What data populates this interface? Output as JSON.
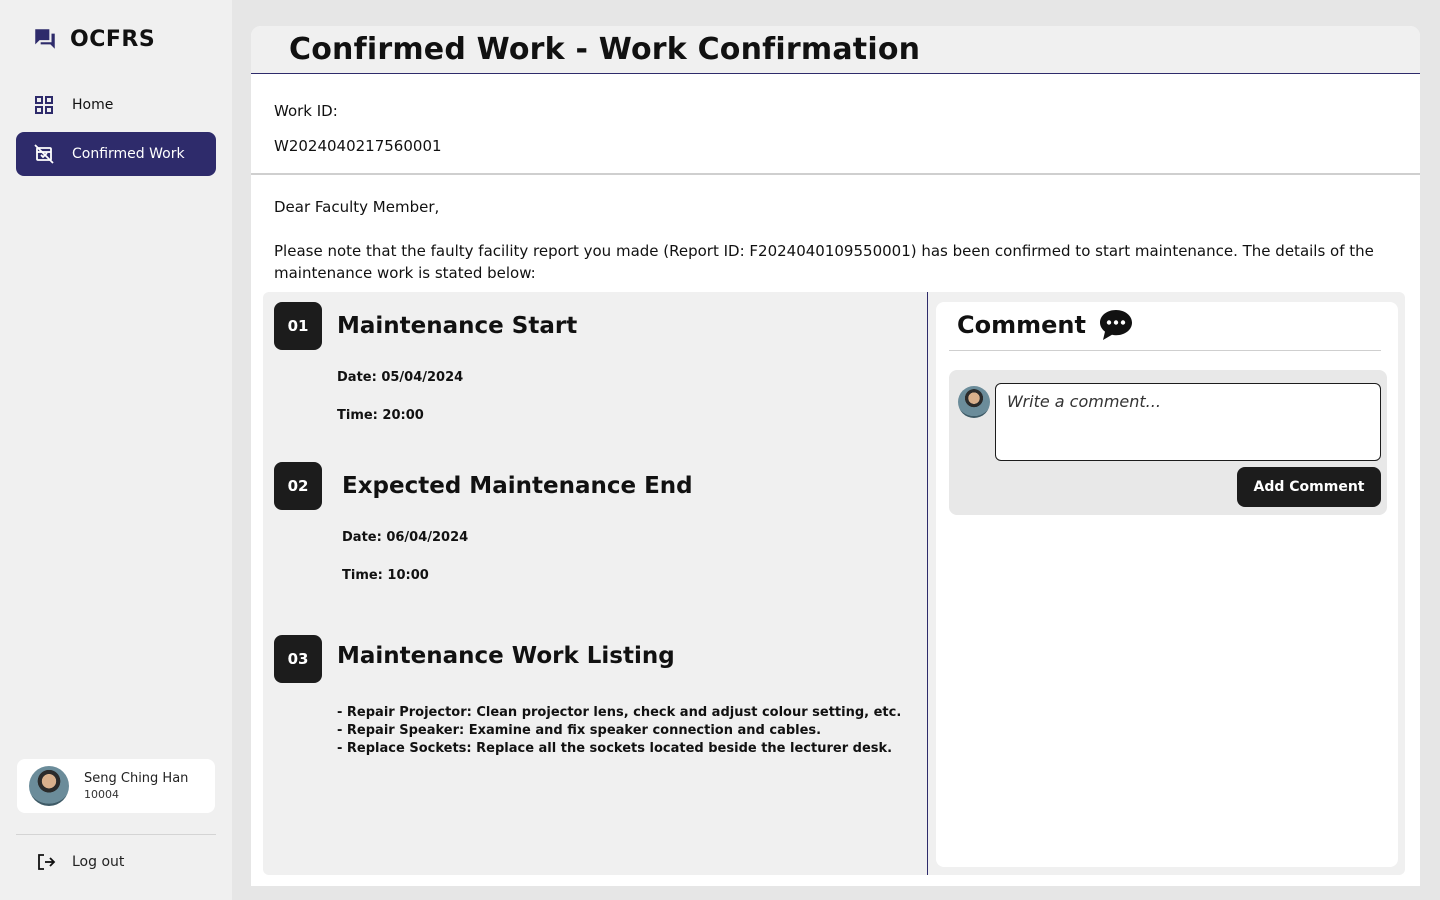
{
  "app": {
    "name": "OCFRS"
  },
  "sidebar": {
    "items": [
      {
        "label": "Home",
        "icon": "grid-icon",
        "active": false
      },
      {
        "label": "Confirmed Work",
        "icon": "confirmed-work-icon",
        "active": true
      }
    ],
    "user": {
      "name": "Seng Ching Han",
      "id": "10004"
    },
    "logout_label": "Log out"
  },
  "page": {
    "title": "Confirmed Work - Work Confirmation",
    "work_id_label": "Work ID:",
    "work_id_value": "W2024040217560001",
    "greeting": "Dear Faculty Member,",
    "message": "Please note that the faulty facility report you made (Report ID: F2024040109550001) has been confirmed to start maintenance. The details of the maintenance work is stated below:"
  },
  "steps": [
    {
      "number": "01",
      "title": "Maintenance Start",
      "date": "Date: 05/04/2024",
      "time": "Time: 20:00"
    },
    {
      "number": "02",
      "title": "Expected Maintenance End",
      "date": "Date: 06/04/2024",
      "time": "Time: 10:00"
    },
    {
      "number": "03",
      "title": "Maintenance Work Listing",
      "items": [
        "- Repair Projector: Clean projector lens, check and adjust colour setting, etc.",
        "- Repair Speaker: Examine and fix speaker connection and cables.",
        "- Replace Sockets: Replace all the sockets located beside the lecturer desk."
      ]
    }
  ],
  "comments": {
    "title": "Comment",
    "placeholder": "Write a comment...",
    "button_label": "Add Comment"
  },
  "colors": {
    "accent": "#2e2b6b",
    "dark": "#1c1c1c",
    "panel": "#f0f0f0"
  }
}
